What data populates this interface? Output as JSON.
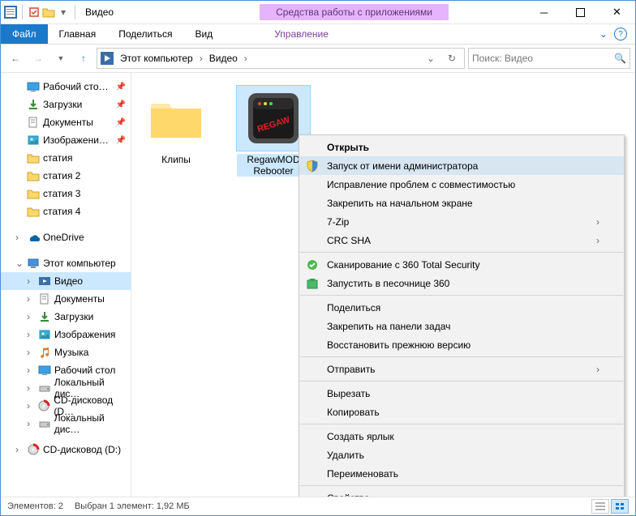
{
  "window_title": "Видео",
  "ribbon_tool_context": "Средства работы с приложениями",
  "ribbon_tabs": {
    "file": "Файл",
    "home": "Главная",
    "share": "Поделиться",
    "view": "Вид",
    "manage": "Управление"
  },
  "breadcrumbs": [
    "Этот компьютер",
    "Видео"
  ],
  "search_placeholder": "Поиск: Видео",
  "tree": {
    "quick": [
      {
        "label": "Рабочий сто…",
        "icon": "desktop",
        "pinned": true
      },
      {
        "label": "Загрузки",
        "icon": "downloads",
        "pinned": true
      },
      {
        "label": "Документы",
        "icon": "documents",
        "pinned": true
      },
      {
        "label": "Изображени…",
        "icon": "pictures",
        "pinned": true
      },
      {
        "label": "статия",
        "icon": "folder",
        "pinned": false
      },
      {
        "label": "статия 2",
        "icon": "folder",
        "pinned": false
      },
      {
        "label": "статия 3",
        "icon": "folder",
        "pinned": false
      },
      {
        "label": "статия 4",
        "icon": "folder",
        "pinned": false
      }
    ],
    "onedrive": "OneDrive",
    "this_pc": "Этот компьютер",
    "pc_children": [
      {
        "label": "Видео",
        "icon": "video",
        "selected": true
      },
      {
        "label": "Документы",
        "icon": "documents"
      },
      {
        "label": "Загрузки",
        "icon": "downloads"
      },
      {
        "label": "Изображения",
        "icon": "pictures"
      },
      {
        "label": "Музыка",
        "icon": "music"
      },
      {
        "label": "Рабочий стол",
        "icon": "desktop"
      },
      {
        "label": "Локальный дис…",
        "icon": "drive"
      },
      {
        "label": "CD-дисковод (D…",
        "icon": "cd-red"
      },
      {
        "label": "Локальный дис…",
        "icon": "drive"
      }
    ],
    "cd_drive": "CD-дисковод (D:)"
  },
  "items": [
    {
      "label": "Клипы",
      "type": "folder",
      "selected": false
    },
    {
      "label": "RegawMOD Rebooter",
      "type": "app",
      "selected": true
    }
  ],
  "context_menu": [
    {
      "label": "Открыть",
      "bold": true
    },
    {
      "label": "Запуск от имени администратора",
      "icon": "shield",
      "highlight": true
    },
    {
      "label": "Исправление проблем с совместимостью"
    },
    {
      "label": "Закрепить на начальном экране"
    },
    {
      "label": "7-Zip",
      "submenu": true
    },
    {
      "label": "CRC SHA",
      "submenu": true
    },
    {
      "sep": true
    },
    {
      "label": "Сканирование с 360 Total Security",
      "icon": "scan"
    },
    {
      "label": "Запустить в песочнице 360",
      "icon": "sandbox"
    },
    {
      "sep": true
    },
    {
      "label": "Поделиться"
    },
    {
      "label": "Закрепить на панели задач"
    },
    {
      "label": "Восстановить прежнюю версию"
    },
    {
      "sep": true
    },
    {
      "label": "Отправить",
      "submenu": true
    },
    {
      "sep": true
    },
    {
      "label": "Вырезать"
    },
    {
      "label": "Копировать"
    },
    {
      "sep": true
    },
    {
      "label": "Создать ярлык"
    },
    {
      "label": "Удалить"
    },
    {
      "label": "Переименовать"
    },
    {
      "sep": true
    },
    {
      "label": "Свойства"
    }
  ],
  "statusbar": {
    "count": "Элементов: 2",
    "selection": "Выбран 1 элемент: 1,92 МБ"
  }
}
